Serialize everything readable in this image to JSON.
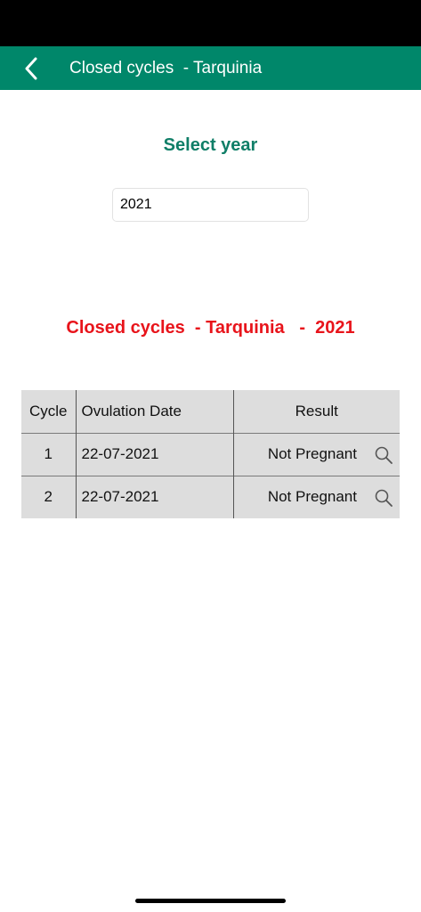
{
  "header": {
    "title": "Closed cycles  - Tarquinia"
  },
  "year_selector": {
    "label": "Select year",
    "value": "2021"
  },
  "section": {
    "title": "Closed cycles  - Tarquinia   -  2021"
  },
  "table": {
    "columns": [
      "Cycle",
      "Ovulation Date",
      "Result"
    ],
    "rows": [
      {
        "cycle": "1",
        "ovulation_date": "22-07-2021",
        "result": "Not Pregnant"
      },
      {
        "cycle": "2",
        "ovulation_date": "22-07-2021",
        "result": "Not Pregnant"
      }
    ]
  },
  "colors": {
    "nav_bar": "#00876a",
    "label_green": "#0f7e67",
    "section_red": "#e8141b",
    "table_bg": "#dddddd"
  },
  "icons": {
    "back": "chevron-left-icon",
    "view": "search-icon"
  }
}
